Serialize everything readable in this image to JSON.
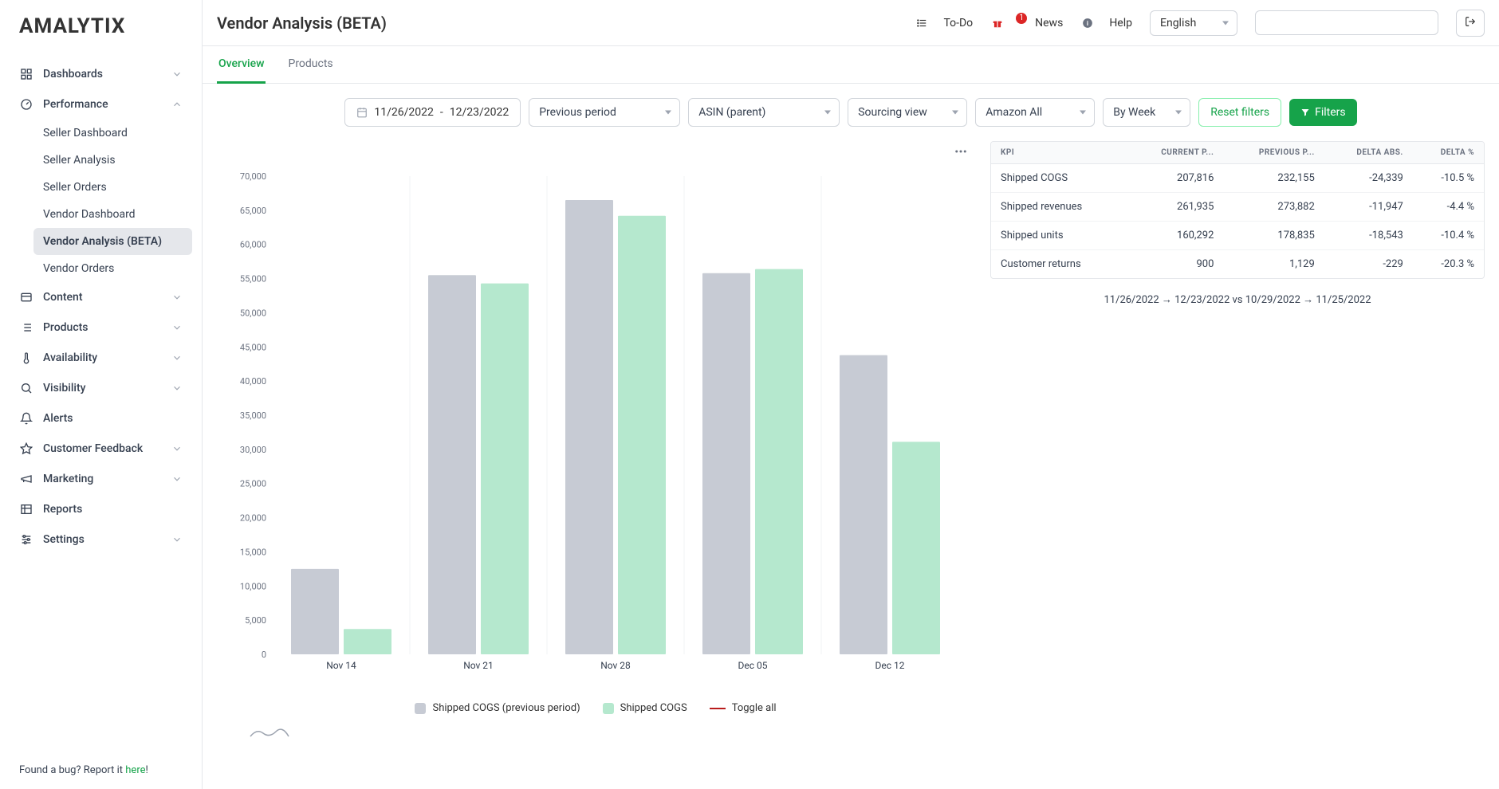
{
  "brand": "AMALYTIX",
  "header": {
    "title": "Vendor Analysis (BETA)",
    "todo": "To-Do",
    "news": "News",
    "news_badge": "1",
    "help": "Help",
    "language": "English"
  },
  "sidebar": {
    "items": [
      {
        "label": "Dashboards",
        "icon": "dashboard",
        "expandable": true,
        "expanded": false
      },
      {
        "label": "Performance",
        "icon": "gauge",
        "expandable": true,
        "expanded": true,
        "children": [
          {
            "label": "Seller Dashboard"
          },
          {
            "label": "Seller Analysis"
          },
          {
            "label": "Seller Orders"
          },
          {
            "label": "Vendor Dashboard"
          },
          {
            "label": "Vendor Analysis (BETA)",
            "active": true
          },
          {
            "label": "Vendor Orders"
          }
        ]
      },
      {
        "label": "Content",
        "icon": "content",
        "expandable": true
      },
      {
        "label": "Products",
        "icon": "list",
        "expandable": true
      },
      {
        "label": "Availability",
        "icon": "thermometer",
        "expandable": true
      },
      {
        "label": "Visibility",
        "icon": "search",
        "expandable": true
      },
      {
        "label": "Alerts",
        "icon": "bell",
        "expandable": false
      },
      {
        "label": "Customer Feedback",
        "icon": "star",
        "expandable": true
      },
      {
        "label": "Marketing",
        "icon": "megaphone",
        "expandable": true
      },
      {
        "label": "Reports",
        "icon": "table",
        "expandable": false
      },
      {
        "label": "Settings",
        "icon": "sliders",
        "expandable": true
      }
    ],
    "bug_prefix": "Found a bug? Report it ",
    "bug_link": "here",
    "bug_suffix": "!"
  },
  "tabs": [
    {
      "label": "Overview",
      "active": true
    },
    {
      "label": "Products",
      "active": false
    }
  ],
  "filters": {
    "date_start": "11/26/2022",
    "date_sep": "-",
    "date_end": "12/23/2022",
    "compare": "Previous period",
    "asin": "ASIN (parent)",
    "view": "Sourcing view",
    "marketplace": "Amazon All",
    "granularity": "By Week",
    "reset": "Reset filters",
    "filters_btn": "Filters"
  },
  "chart_data": {
    "type": "bar",
    "ylabel": "",
    "ylim": [
      0,
      70000
    ],
    "yticks": [
      0,
      5000,
      10000,
      15000,
      20000,
      25000,
      30000,
      35000,
      40000,
      45000,
      50000,
      55000,
      60000,
      65000,
      70000
    ],
    "ytick_labels": [
      "0",
      "5,000",
      "10,000",
      "15,000",
      "20,000",
      "25,000",
      "30,000",
      "35,000",
      "40,000",
      "45,000",
      "50,000",
      "55,000",
      "60,000",
      "65,000",
      "70,000"
    ],
    "categories": [
      "Nov 14",
      "Nov 21",
      "Nov 28",
      "Dec 05",
      "Dec 12"
    ],
    "series": [
      {
        "name": "Shipped COGS (previous period)",
        "color": "#c7cbd4",
        "values": [
          12500,
          55500,
          66500,
          55800,
          43800
        ]
      },
      {
        "name": "Shipped COGS",
        "color": "#b5e8ce",
        "values": [
          3700,
          54300,
          64200,
          56400,
          31100
        ]
      }
    ],
    "toggle_label": "Toggle all"
  },
  "kpi": {
    "columns": [
      "KPI",
      "CURRENT P...",
      "PREVIOUS P...",
      "DELTA ABS.",
      "DELTA %"
    ],
    "rows": [
      {
        "label": "Shipped COGS",
        "current": "207,816",
        "previous": "232,155",
        "delta_abs": "-24,339",
        "delta_pct": "-10.5 %",
        "neg": true
      },
      {
        "label": "Shipped revenues",
        "current": "261,935",
        "previous": "273,882",
        "delta_abs": "-11,947",
        "delta_pct": "-4.4 %",
        "neg": true
      },
      {
        "label": "Shipped units",
        "current": "160,292",
        "previous": "178,835",
        "delta_abs": "-18,543",
        "delta_pct": "-10.4 %",
        "neg": true
      },
      {
        "label": "Customer returns",
        "current": "900",
        "previous": "1,129",
        "delta_abs": "-229",
        "delta_pct": "-20.3 %",
        "neg": true
      }
    ]
  },
  "range_note": "11/26/2022 → 12/23/2022 vs 10/29/2022 → 11/25/2022"
}
